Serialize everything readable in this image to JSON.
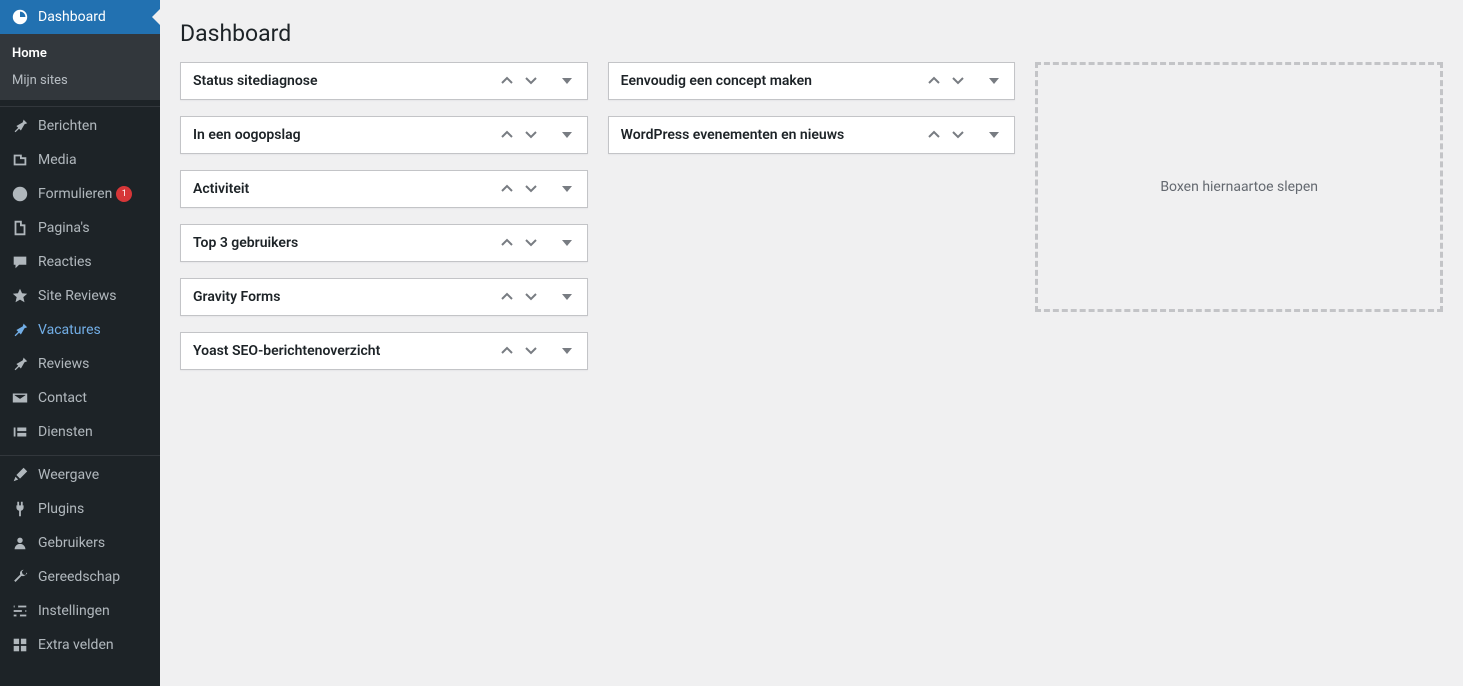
{
  "page": {
    "title": "Dashboard"
  },
  "sidebar": {
    "items": [
      {
        "label": "Dashboard",
        "icon": "dashboard",
        "current": true
      },
      {
        "label": "Berichten",
        "icon": "pin"
      },
      {
        "label": "Media",
        "icon": "media"
      },
      {
        "label": "Formulieren",
        "icon": "forms",
        "badge": "1"
      },
      {
        "label": "Pagina's",
        "icon": "pages"
      },
      {
        "label": "Reacties",
        "icon": "comments"
      },
      {
        "label": "Site Reviews",
        "icon": "star"
      },
      {
        "label": "Vacatures",
        "icon": "pin",
        "highlight": true
      },
      {
        "label": "Reviews",
        "icon": "pin"
      },
      {
        "label": "Contact",
        "icon": "mail"
      },
      {
        "label": "Diensten",
        "icon": "diensten"
      },
      {
        "label": "Weergave",
        "icon": "brush"
      },
      {
        "label": "Plugins",
        "icon": "plug"
      },
      {
        "label": "Gebruikers",
        "icon": "user"
      },
      {
        "label": "Gereedschap",
        "icon": "wrench"
      },
      {
        "label": "Instellingen",
        "icon": "settings"
      },
      {
        "label": "Extra velden",
        "icon": "extra"
      }
    ],
    "submenu": [
      {
        "label": "Home",
        "current": true
      },
      {
        "label": "Mijn sites"
      }
    ]
  },
  "widgets": {
    "col1": [
      {
        "title": "Status sitediagnose"
      },
      {
        "title": "In een oogopslag"
      },
      {
        "title": "Activiteit"
      },
      {
        "title": "Top 3 gebruikers"
      },
      {
        "title": "Gravity Forms"
      },
      {
        "title": "Yoast SEO-berichtenoverzicht"
      }
    ],
    "col2": [
      {
        "title": "Eenvoudig een concept maken"
      },
      {
        "title": "WordPress evenementen en nieuws"
      }
    ],
    "col3": {
      "placeholder": "Boxen hiernaartoe slepen"
    }
  }
}
